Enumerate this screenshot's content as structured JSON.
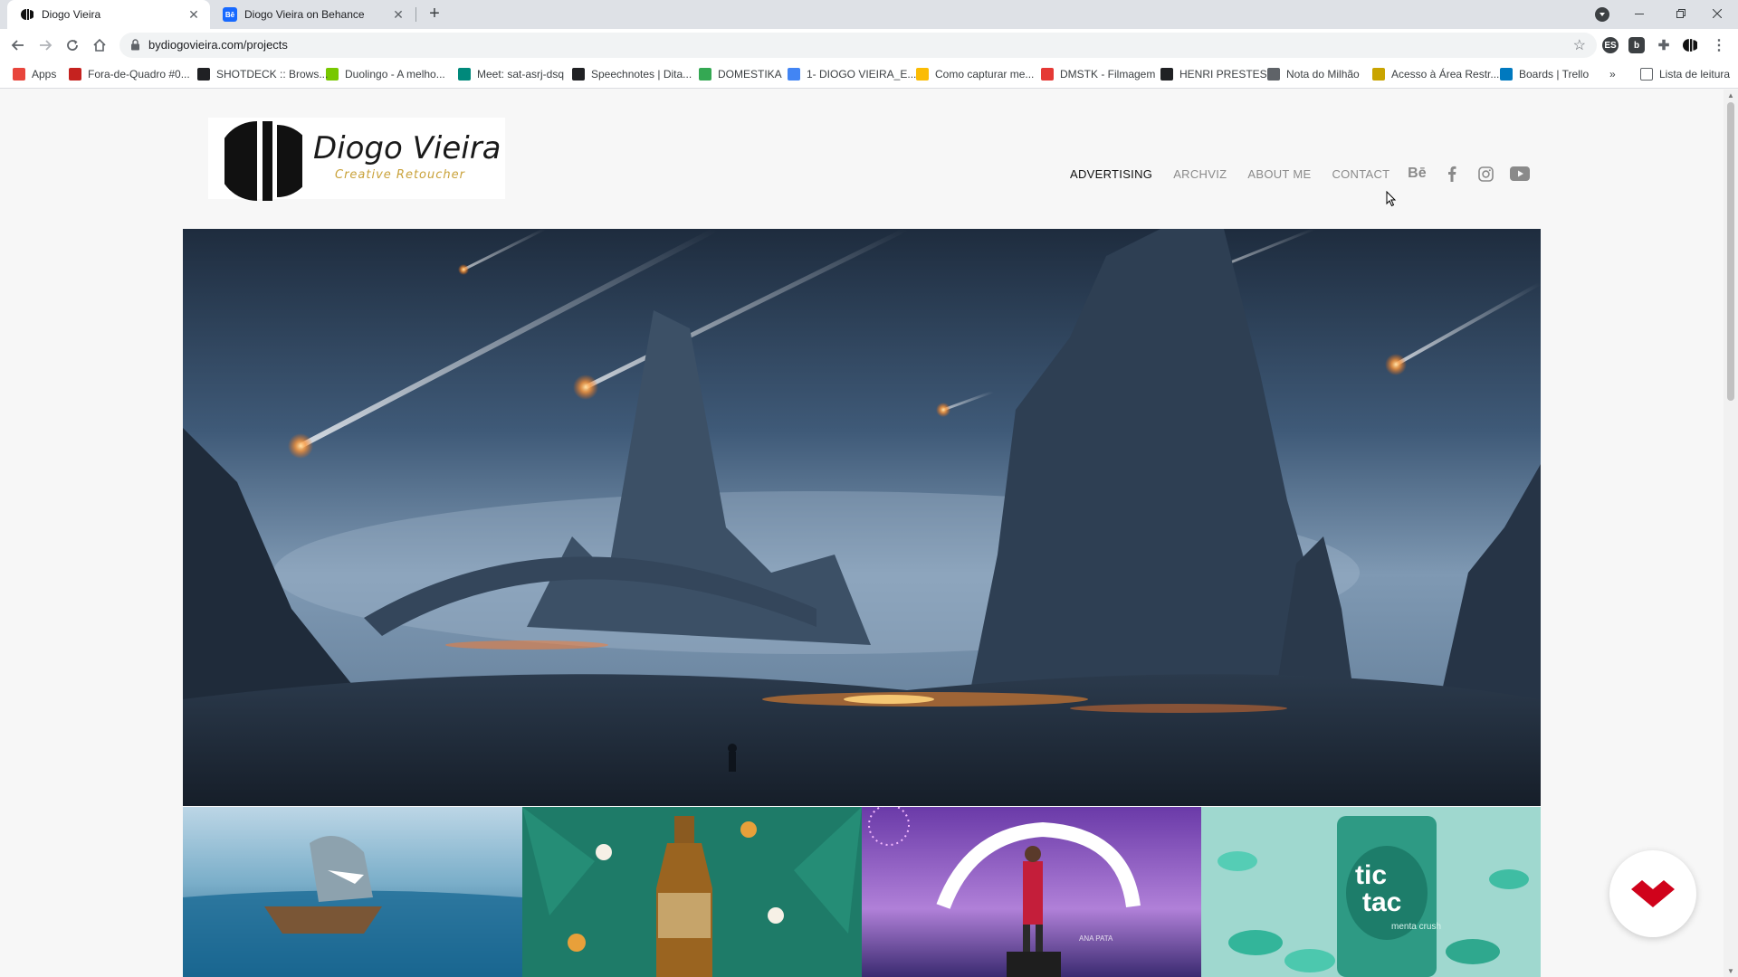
{
  "browser": {
    "tabs": [
      {
        "title": "Diogo Vieira",
        "icon": "dv-logo-icon",
        "active": true
      },
      {
        "title": "Diogo Vieira on Behance",
        "icon": "behance-icon",
        "active": false
      }
    ],
    "url": "bydiogovieira.com/projects",
    "extensions": [
      "ES",
      "b"
    ],
    "bookmarks": [
      {
        "label": "Apps",
        "icon": "apps-grid-icon",
        "color": "#e8453c"
      },
      {
        "label": "Fora-de-Quadro #0...",
        "icon": "clapper-icon",
        "color": "#c5221f"
      },
      {
        "label": "SHOTDECK :: Brows...",
        "icon": "shotdeck-icon",
        "color": "#202124"
      },
      {
        "label": "Duolingo - A melho...",
        "icon": "duolingo-icon",
        "color": "#78c800"
      },
      {
        "label": "Meet: sat-asrj-dsq",
        "icon": "meet-icon",
        "color": "#00897b"
      },
      {
        "label": "Speechnotes | Dita...",
        "icon": "mic-icon",
        "color": "#202124"
      },
      {
        "label": "DOMESTIKA",
        "icon": "drive-icon",
        "color": "#34a853"
      },
      {
        "label": "1- DIOGO VIEIRA_E...",
        "icon": "docs-icon",
        "color": "#4285f4"
      },
      {
        "label": "Como capturar me...",
        "icon": "drive-icon",
        "color": "#fbbc04"
      },
      {
        "label": "DMSTK - Filmagem",
        "icon": "domestika-icon",
        "color": "#e53935"
      },
      {
        "label": "HENRI PRESTES",
        "icon": "henri-icon",
        "color": "#202124"
      },
      {
        "label": "Nota do Milhão",
        "icon": "globe-icon",
        "color": "#5f6368"
      },
      {
        "label": "Acesso à Área Restr...",
        "icon": "lock-badge-icon",
        "color": "#c9a400"
      },
      {
        "label": "Boards | Trello",
        "icon": "trello-icon",
        "color": "#0079bf"
      }
    ],
    "more": "»",
    "reading_list": "Lista de leitura"
  },
  "site": {
    "brand_name": "Diogo Vieira",
    "brand_tagline": "Creative Retoucher",
    "nav": [
      {
        "label": "ADVERTISING",
        "active": true
      },
      {
        "label": "ARCHVIZ",
        "active": false
      },
      {
        "label": "ABOUT ME",
        "active": false
      },
      {
        "label": "CONTACT",
        "active": false
      }
    ],
    "social": [
      "behance-icon",
      "facebook-icon",
      "instagram-icon",
      "youtube-icon"
    ],
    "behance_text": "Bē",
    "hero": {
      "alt": "alien mountain landscape with meteors"
    },
    "thumbnails": [
      {
        "name": "shark-boat"
      },
      {
        "name": "prata-beer"
      },
      {
        "name": "fireworks-stage",
        "text": "ANA PATA"
      },
      {
        "name": "tic-tac",
        "text_top": "tic",
        "text_bottom": "tac",
        "text_sub": "menta crush"
      }
    ],
    "accent": "#d0021b"
  }
}
